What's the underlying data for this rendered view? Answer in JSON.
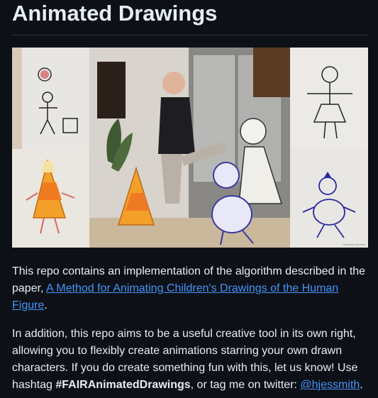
{
  "page": {
    "title": "Animated Drawings"
  },
  "hero_image": {
    "description_icon": "children-drawings-collage-image",
    "watermark": "Drawings by Meta"
  },
  "intro": {
    "text_before_link": "This repo contains an implementation of the algorithm described in the paper, ",
    "paper_link": "A Method for Animating Children's Drawings of the Human Figure",
    "text_after_link": "."
  },
  "addition": {
    "text_1": "In addition, this repo aims to be a useful creative tool in its own right, allowing you to flexibly create animations starring your own drawn characters. If you do create something fun with this, let us know! Use hashtag ",
    "hashtag": "#FAIRAnimatedDrawings",
    "text_2": ", or tag me on twitter: ",
    "twitter_link": "@hjessmith",
    "text_3": "."
  },
  "colors": {
    "background": "#0d1117",
    "text": "#e6edf3",
    "link": "#4493f8",
    "divider": "#30363d"
  }
}
